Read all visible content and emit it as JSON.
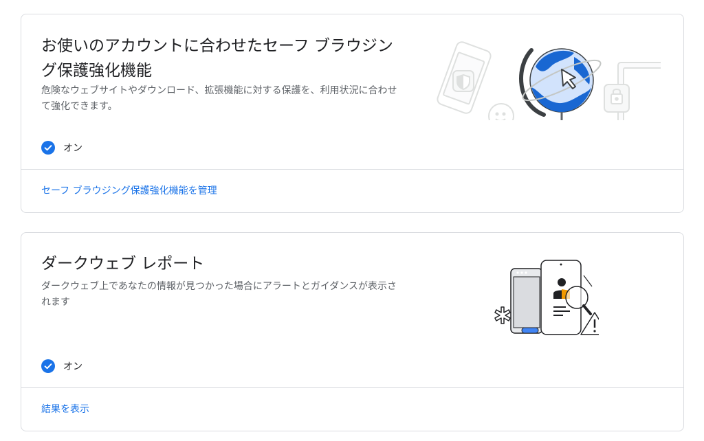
{
  "cards": [
    {
      "title": "お使いのアカウントに合わせたセーフ ブラウジング保護強化機能",
      "description": "危険なウェブサイトやダウンロード、拡張機能に対する保護を、利用状況に合わせて強化できます。",
      "status": "オン",
      "link": "セーフ ブラウジング保護強化機能を管理",
      "illustration": "safe-browsing-globe-illustration"
    },
    {
      "title": "ダークウェブ レポート",
      "description": "ダークウェブ上であなたの情報が見つかった場合にアラートとガイダンスが表示されます",
      "status": "オン",
      "link": "結果を表示",
      "illustration": "dark-web-report-illustration"
    }
  ],
  "colors": {
    "accent_blue": "#1a73e8",
    "check_blue": "#1a73e8",
    "border": "#dadce0",
    "text_primary": "#202124",
    "text_secondary": "#5f6368",
    "globe_light_blue": "#d2e3fc",
    "globe_dark_blue": "#1967d2",
    "warning_orange": "#f29900"
  }
}
